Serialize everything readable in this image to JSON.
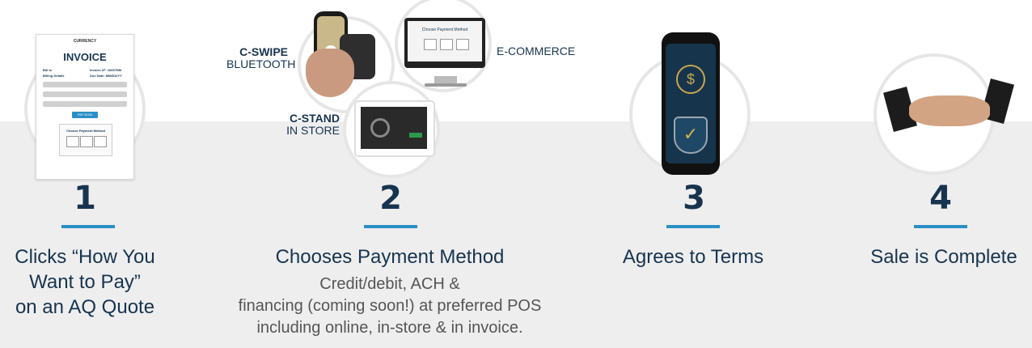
{
  "steps": [
    {
      "number": "1",
      "title_lines": [
        "Clicks “How You",
        "Want to Pay”",
        "on an AQ Quote"
      ]
    },
    {
      "number": "2",
      "title": "Chooses Payment Method",
      "desc_lines": [
        "Credit/debit, ACH &",
        "financing (coming soon!) at preferred POS",
        "including online, in-store & in invoice."
      ]
    },
    {
      "number": "3",
      "title": "Agrees to Terms"
    },
    {
      "number": "4",
      "title": "Sale is Complete"
    }
  ],
  "labels": {
    "cswipe": {
      "top": "C-SWIPE",
      "bottom": "BLUETOOTH"
    },
    "ecommerce": "E-COMMERCE",
    "cstand": {
      "top": "C-STAND",
      "bottom": "IN STORE"
    }
  },
  "invoice": {
    "brand": "CURRENCY",
    "title": "INVOICE",
    "bill_to": "Bill to",
    "billing_details": "Billing Details",
    "invoice_no": "Invoice Nº: 16057NM",
    "due_date": "Due Date: MM/DD/YY",
    "pay_now": "PAY NOW",
    "choose": "Choose Payment Method"
  },
  "monitor": {
    "screen_title": "Choose Payment Method"
  },
  "colors": {
    "navy": "#17344f",
    "accent": "#2b8fc7",
    "band": "#efeeef"
  }
}
